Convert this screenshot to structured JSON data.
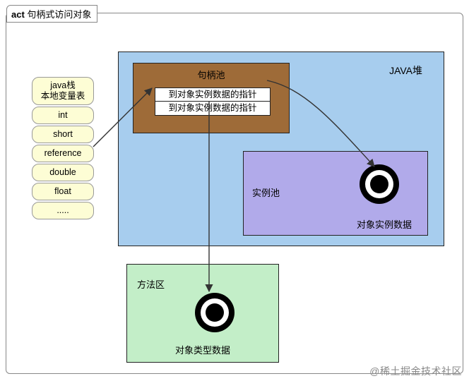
{
  "frame": {
    "title_bold": "act",
    "title_rest": " 句柄式访问对象"
  },
  "stack": {
    "header": "java栈\n本地变量表",
    "items": [
      "int",
      "short",
      "reference",
      "double",
      "float",
      "....."
    ]
  },
  "heap": {
    "label": "JAVA堆",
    "handle_pool": {
      "label": "句柄池",
      "pointer_a": "到对象实例数据的指针",
      "pointer_b": "到对象实例数据的指针"
    },
    "instance_pool": {
      "label": "实例池",
      "object_label": "对象实例数据"
    }
  },
  "method_area": {
    "label": "方法区",
    "object_label": "对象类型数据"
  },
  "watermark": "@稀土掘金技术社区"
}
